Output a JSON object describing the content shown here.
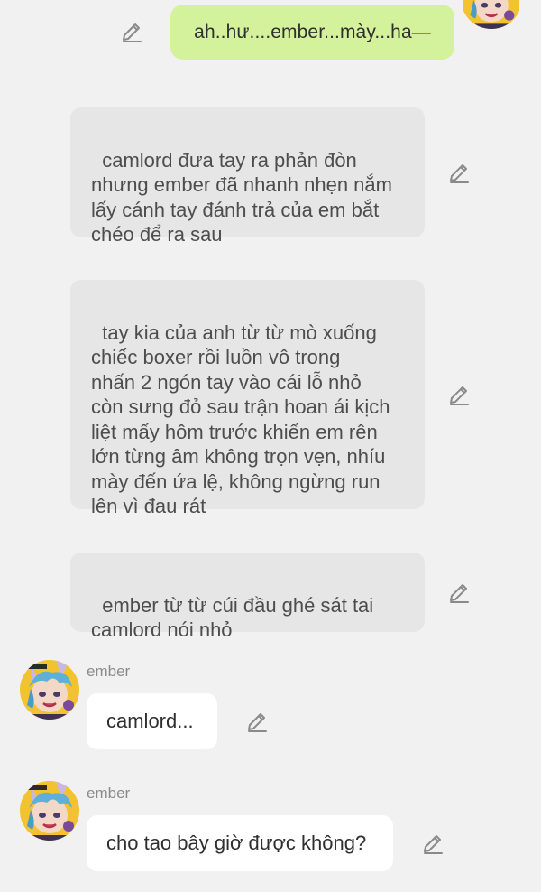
{
  "messages": {
    "sent_top": {
      "text": "ah..hư....ember...mày...ha—"
    },
    "narration": [
      {
        "text": "camlord đưa tay ra phản đòn\nnhưng ember đã nhanh nhẹn nắm\nlấy cánh tay đánh trả của em bắt\nchéo để ra sau"
      },
      {
        "text": "tay kia của anh từ từ mò xuống\nchiếc boxer rồi luồn vô trong\nnhấn 2 ngón tay vào cái lỗ nhỏ\ncòn sưng đỏ sau trận hoan ái kịch\nliệt mấy hôm trước khiến em rên\nlớn từng âm không trọn vẹn, nhíu\nmày đến ứa lệ, không ngừng run\nlên vì đau rát"
      },
      {
        "text": "ember từ từ cúi đầu ghé sát tai\ncamlord nói nhỏ"
      }
    ],
    "character": [
      {
        "name": "ember",
        "text": "camlord..."
      },
      {
        "name": "ember",
        "text": "cho tao bây giờ được không?"
      }
    ]
  },
  "colors": {
    "background": "#f1f1f1",
    "sent_bubble": "#d4f19b",
    "narration_bubble": "#e6e6e6",
    "received_bubble": "#ffffff",
    "name_text": "#8b8b8b"
  },
  "icons": {
    "edit": "pencil-edit-icon",
    "avatar": "ember-avatar"
  }
}
